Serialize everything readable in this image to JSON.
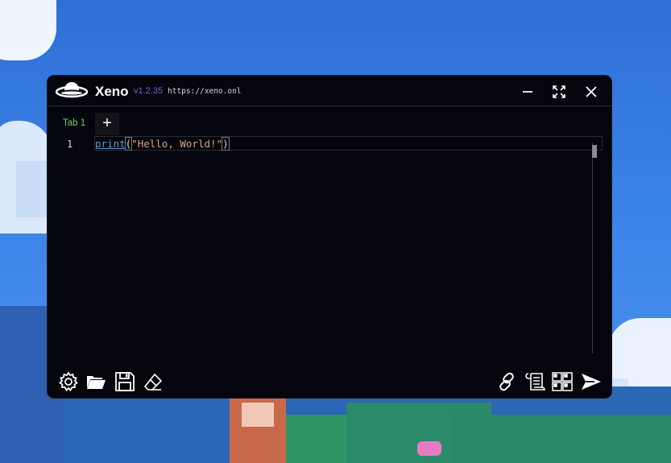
{
  "app": {
    "name": "Xeno",
    "version": "v1.2.35",
    "url": "https://xeno.onl"
  },
  "tabs": [
    {
      "label": "Tab 1",
      "active": true
    }
  ],
  "add_tab_label": "+",
  "editor": {
    "lines": [
      {
        "number": "1",
        "keyword": "print",
        "open": "(",
        "string": "\"Hello, World!\"",
        "close": ")"
      }
    ]
  },
  "icons": {
    "logo": "planet-logo-icon",
    "minimize": "minimize-icon",
    "maximize": "maximize-icon",
    "close": "close-icon",
    "settings": "gear-icon",
    "open": "folder-icon",
    "save": "floppy-disk-icon",
    "clear": "eraser-icon",
    "link": "link-icon",
    "script": "scroll-icon",
    "attach": "client-grid-icon",
    "execute": "send-icon"
  },
  "colors": {
    "window_bg": "#05050d",
    "version": "#6f63d8",
    "tab_active": "#6cd36c",
    "keyword": "#5b9bd5",
    "string": "#e1a07a"
  }
}
